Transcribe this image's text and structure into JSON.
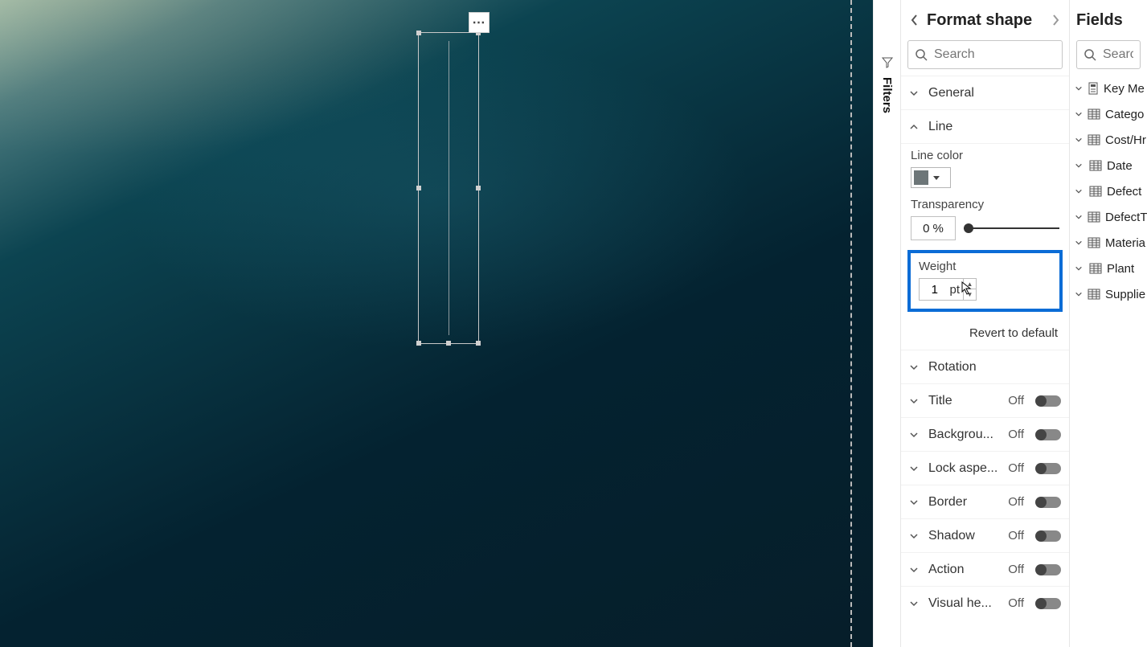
{
  "filters_label": "Filters",
  "format_panel": {
    "title": "Format shape",
    "search_placeholder": "Search",
    "sections": {
      "general": "General",
      "line": "Line",
      "rotation": "Rotation",
      "title": "Title",
      "background": "Backgrou...",
      "lock_aspect": "Lock aspe...",
      "border": "Border",
      "shadow": "Shadow",
      "action": "Action",
      "visual_header": "Visual he..."
    },
    "toggle_off": "Off",
    "line": {
      "color_label": "Line color",
      "color_hex": "#6d7678",
      "transparency_label": "Transparency",
      "transparency_value": "0",
      "transparency_unit": "%",
      "weight_label": "Weight",
      "weight_value": "1",
      "weight_unit": "pt",
      "revert": "Revert to default"
    }
  },
  "fields_panel": {
    "title": "Fields",
    "search_placeholder": "Search",
    "items": [
      {
        "label": "Key Me",
        "icon": "measure"
      },
      {
        "label": "Catego",
        "icon": "table"
      },
      {
        "label": "Cost/Hr",
        "icon": "table"
      },
      {
        "label": "Date",
        "icon": "table"
      },
      {
        "label": "Defect",
        "icon": "table"
      },
      {
        "label": "DefectT",
        "icon": "table"
      },
      {
        "label": "Materia",
        "icon": "table"
      },
      {
        "label": "Plant",
        "icon": "table"
      },
      {
        "label": "Supplie",
        "icon": "table"
      }
    ]
  },
  "shape_menu": "⋯"
}
